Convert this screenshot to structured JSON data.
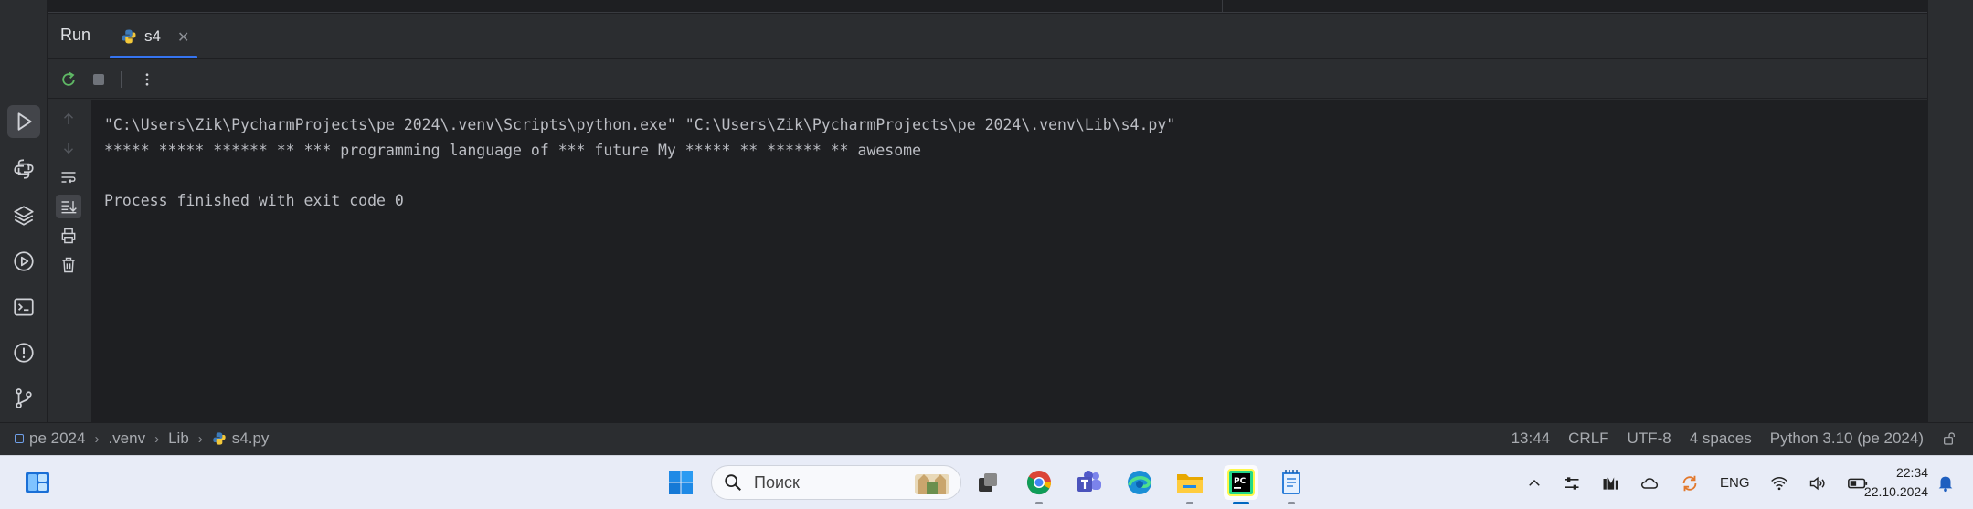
{
  "run_panel": {
    "title": "Run",
    "tab_label": "s4"
  },
  "console": {
    "lines": [
      "\"C:\\Users\\Zik\\PycharmProjects\\pe 2024\\.venv\\Scripts\\python.exe\" \"C:\\Users\\Zik\\PycharmProjects\\pe 2024\\.venv\\Lib\\s4.py\"",
      "***** ***** ****** ** *** programming language of *** future My ***** ** ****** ** awesome",
      "",
      "Process finished with exit code 0"
    ]
  },
  "status_bar": {
    "breadcrumbs": [
      "pe 2024",
      ".venv",
      "Lib",
      "s4.py"
    ],
    "position": "13:44",
    "line_separator": "CRLF",
    "encoding": "UTF-8",
    "indent": "4 spaces",
    "interpreter": "Python 3.10 (pe 2024)"
  },
  "taskbar": {
    "search_placeholder": "Поиск",
    "language": "ENG",
    "time": "22:34",
    "date": "22.10.2024"
  },
  "colors": {
    "accent": "#3574f0",
    "rerun_green": "#5fb865",
    "panel_bg": "#2b2d30",
    "console_bg": "#1e1f22"
  }
}
